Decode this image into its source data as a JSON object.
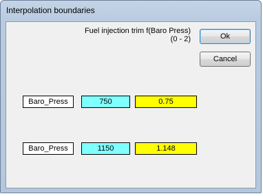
{
  "window": {
    "title": "Interpolation boundaries"
  },
  "description": {
    "line1": "Fuel injection trim f(Baro Press)",
    "line2": "(0 - 2)"
  },
  "buttons": {
    "ok_label": "Ok",
    "cancel_label": "Cancel"
  },
  "rows": [
    {
      "name": "Baro_Press",
      "value": "750",
      "result": "0.75"
    },
    {
      "name": "Baro_Press",
      "value": "1150",
      "result": "1.148"
    }
  ],
  "colors": {
    "value_bg": "#80ffff",
    "result_bg": "#ffff00"
  }
}
